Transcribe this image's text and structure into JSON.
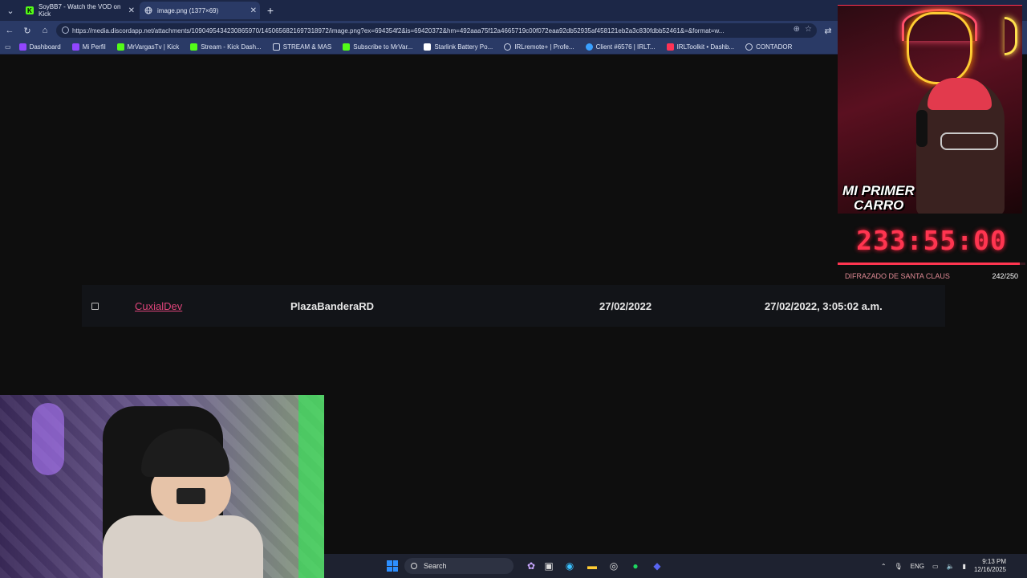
{
  "browser": {
    "tabs": [
      {
        "title": "SoyBB7 - Watch the VOD on Kick",
        "favicon": "kick-icon",
        "color": "#53fc18"
      },
      {
        "title": "image.png (1377×69)",
        "favicon": "globe-icon",
        "color": "#cfd6e8"
      }
    ],
    "url": "https://media.discordapp.net/attachments/1090495434230865970/1450656821697318972/image.png?ex=694354f2&is=69420372&hm=492aaa75f12a4665719c00f072eaa92db52935af458121eb2a3c830fdbb52461&=&format=w...",
    "bookmarks": [
      {
        "label": "Dashboard",
        "color": "#9146ff"
      },
      {
        "label": "Mi Perfil",
        "color": "#9146ff"
      },
      {
        "label": "MrVargasTv | Kick",
        "color": "#53fc18"
      },
      {
        "label": "Stream - Kick Dash...",
        "color": "#53fc18"
      },
      {
        "label": "STREAM & MAS",
        "color": "#cfd6e8"
      },
      {
        "label": "Subscribe to MrVar...",
        "color": "#53fc18"
      },
      {
        "label": "Starlink Battery Po...",
        "color": "#ffffff"
      },
      {
        "label": "IRLremote+ | Profe...",
        "color": "#cfd6e8"
      },
      {
        "label": "Client #6576 | IRLT...",
        "color": "#3aa0ff"
      },
      {
        "label": "IRLToolkit • Dashb...",
        "color": "#ff3355"
      },
      {
        "label": "CONTADOR",
        "color": "#cfd6e8"
      }
    ]
  },
  "row": {
    "user": "CuxialDev",
    "location": "PlazaBanderaRD",
    "date": "27/02/2022",
    "datetime": "27/02/2022, 3:05:02 a.m."
  },
  "overlay": {
    "badge_line1": "MI PRIMER",
    "badge_line2": "CARRO",
    "timer": "233:55:00",
    "goal_label": "DIFRAZADO DE SANTA CLAUS",
    "goal_count": "242/250",
    "goal_progress": 0.968
  },
  "taskbar": {
    "search_placeholder": "Search",
    "lang": "ENG",
    "time": "9:13 PM",
    "date": "12/16/2025"
  }
}
